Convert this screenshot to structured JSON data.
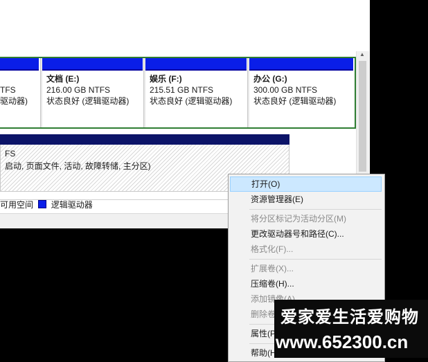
{
  "partitions": [
    {
      "name": "",
      "size": "TFS",
      "status": "驱动器)"
    },
    {
      "name": "文档 (E:)",
      "size": "216.00 GB NTFS",
      "status": "状态良好 (逻辑驱动器)"
    },
    {
      "name": "娱乐 (F:)",
      "size": "215.51 GB NTFS",
      "status": "状态良好 (逻辑驱动器)"
    },
    {
      "name": "办公 (G:)",
      "size": "300.00 GB NTFS",
      "status": "状态良好 (逻辑驱动器)"
    }
  ],
  "system_partition": {
    "line1": "FS",
    "line2": "启动, 页面文件, 活动, 故障转储, 主分区)"
  },
  "legend": {
    "unallocated": "可用空间",
    "logical": "逻辑驱动器"
  },
  "context_menu": [
    {
      "label": "打开(O)",
      "state": "highlighted"
    },
    {
      "label": "资源管理器(E)",
      "state": "enabled"
    },
    {
      "label": "将分区标记为活动分区(M)",
      "state": "disabled"
    },
    {
      "label": "更改驱动器号和路径(C)...",
      "state": "enabled"
    },
    {
      "label": "格式化(F)...",
      "state": "disabled"
    },
    {
      "label": "扩展卷(X)...",
      "state": "disabled"
    },
    {
      "label": "压缩卷(H)...",
      "state": "enabled"
    },
    {
      "label": "添加镜像(A)...",
      "state": "disabled"
    },
    {
      "label": "删除卷",
      "state": "disabled"
    },
    {
      "label": "属性(P",
      "state": "enabled"
    },
    {
      "label": "帮助(H",
      "state": "enabled"
    }
  ],
  "watermark": {
    "line1": "爱家爱生活爱购物",
    "line2": "www.652300.cn"
  },
  "colors": {
    "partition_bar": "#0a1ee8",
    "system_bar": "#0c1468",
    "selected_border": "#2e7d32",
    "menu_highlight": "#cce8ff"
  }
}
